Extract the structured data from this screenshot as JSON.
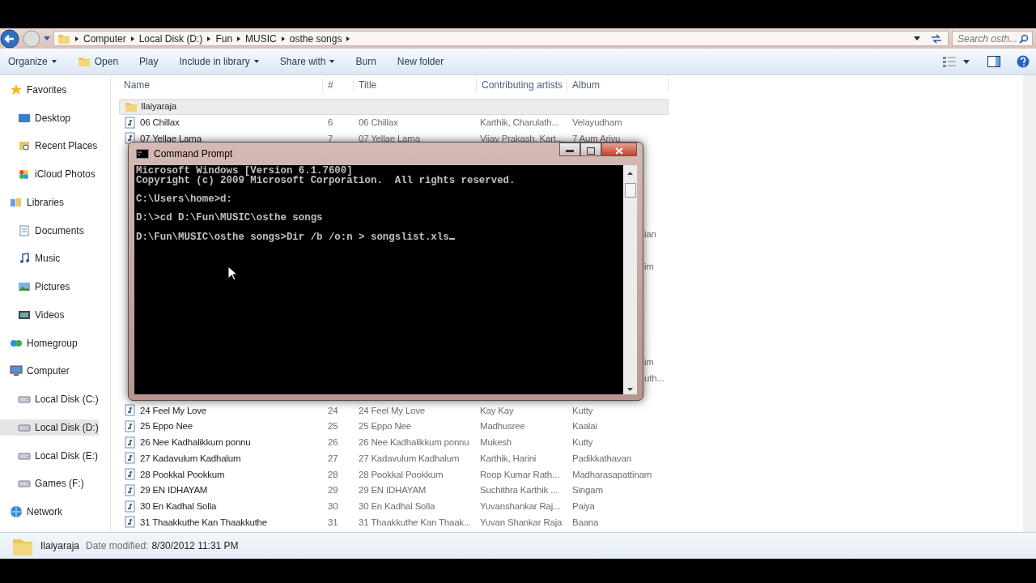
{
  "address_bar": {
    "breadcrumb": [
      "Computer",
      "Local Disk (D:)",
      "Fun",
      "MUSIC",
      "osthe songs"
    ],
    "search_placeholder": "Search osth..."
  },
  "toolbar": {
    "buttons": [
      {
        "label": "Organize",
        "kind": "menu"
      },
      {
        "label": "Open",
        "kind": "open"
      },
      {
        "label": "Play",
        "kind": "plain"
      },
      {
        "label": "Include in library",
        "kind": "menu"
      },
      {
        "label": "Share with",
        "kind": "menu"
      },
      {
        "label": "Burn",
        "kind": "plain"
      },
      {
        "label": "New folder",
        "kind": "plain"
      }
    ]
  },
  "sidebar": {
    "groups": [
      {
        "label": "Favorites",
        "kind": "star",
        "selected": false,
        "children": [
          {
            "label": "Desktop",
            "kind": "desktop",
            "selected": false
          },
          {
            "label": "Recent Places",
            "kind": "recent",
            "selected": false
          },
          {
            "label": "iCloud Photos",
            "kind": "photos",
            "selected": false
          }
        ]
      },
      {
        "label": "Libraries",
        "kind": "library",
        "selected": false,
        "children": [
          {
            "label": "Documents",
            "kind": "documents",
            "selected": false
          },
          {
            "label": "Music",
            "kind": "music",
            "selected": false
          },
          {
            "label": "Pictures",
            "kind": "pictures",
            "selected": false
          },
          {
            "label": "Videos",
            "kind": "videos",
            "selected": false
          }
        ]
      },
      {
        "label": "Homegroup",
        "kind": "homegroup",
        "selected": false
      },
      {
        "label": "Computer",
        "kind": "computer",
        "selected": false,
        "children": [
          {
            "label": "Local Disk (C:)",
            "kind": "disk",
            "selected": false
          },
          {
            "label": "Local Disk (D:)",
            "kind": "disk",
            "selected": true
          },
          {
            "label": "Local Disk (E:)",
            "kind": "disk",
            "selected": false
          },
          {
            "label": "Games (F:)",
            "kind": "disk",
            "selected": false
          }
        ]
      },
      {
        "label": "Network",
        "kind": "network",
        "selected": false
      }
    ]
  },
  "table": {
    "columns": [
      "Name",
      "#",
      "Title",
      "Contributing artists",
      "Album"
    ],
    "rows": [
      {
        "kind": "folder",
        "name": "Ilaiyaraja",
        "selected": true
      },
      {
        "kind": "song",
        "name": "06 Chillax",
        "number": "6",
        "title": "06 Chillax",
        "artists": "Karthik, Charulath...",
        "album": "Velayudham",
        "selected": false
      },
      {
        "kind": "song",
        "name": "07 Yellae Lama",
        "number": "7",
        "title": "07 Yellae Lama",
        "artists": "Vijay Prakash, Kart...",
        "album": "7 Aum Arivu",
        "selected": false
      },
      {
        "kind": "covered"
      },
      {
        "kind": "covered"
      },
      {
        "kind": "covered"
      },
      {
        "kind": "covered"
      },
      {
        "kind": "covered"
      },
      {
        "kind": "covered",
        "album": "ian"
      },
      {
        "kind": "covered"
      },
      {
        "kind": "covered",
        "album": "im"
      },
      {
        "kind": "covered"
      },
      {
        "kind": "covered"
      },
      {
        "kind": "covered"
      },
      {
        "kind": "covered"
      },
      {
        "kind": "covered"
      },
      {
        "kind": "covered",
        "album": "im"
      },
      {
        "kind": "covered",
        "album": "uth..."
      },
      {
        "kind": "covered"
      },
      {
        "kind": "song",
        "name": "24 Feel My Love",
        "number": "24",
        "title": "24 Feel My Love",
        "artists": "Kay Kay",
        "album": "Kutty",
        "selected": false
      },
      {
        "kind": "song",
        "name": "25 Eppo Nee",
        "number": "25",
        "title": "25 Eppo Nee",
        "artists": "Madhusree",
        "album": "Kaalai",
        "selected": false
      },
      {
        "kind": "song",
        "name": "26 Nee Kadhalikkum ponnu",
        "number": "26",
        "title": "26 Nee Kadhalikkum ponnu",
        "artists": "Mukesh",
        "album": "Kutty",
        "selected": false
      },
      {
        "kind": "song",
        "name": "27 Kadavulum Kadhalum",
        "number": "27",
        "title": "27 Kadavulum Kadhalum",
        "artists": "Karthik, Harini",
        "album": "Padikkathavan",
        "selected": false
      },
      {
        "kind": "song",
        "name": "28 Pookkal Pookkum",
        "number": "28",
        "title": "28 Pookkal Pookkum",
        "artists": "Roop Kumar Rath...",
        "album": "Madharasapattinam",
        "selected": false
      },
      {
        "kind": "song",
        "name": "29 EN IDHAYAM",
        "number": "29",
        "title": "29 EN IDHAYAM",
        "artists": "Suchithra Karthik ...",
        "album": "Singam",
        "selected": false
      },
      {
        "kind": "song",
        "name": "30 En Kadhal Solla",
        "number": "30",
        "title": "30 En Kadhal Solla",
        "artists": "Yuvanshankar Raj...",
        "album": "Paiya",
        "selected": false
      },
      {
        "kind": "song",
        "name": "31 Thaakkuthe Kan Thaakkuthe",
        "number": "31",
        "title": "31 Thaakkuthe Kan Thaak...",
        "artists": "Yuvan Shankar Raja",
        "album": "Baana",
        "selected": false
      }
    ]
  },
  "status_bar": {
    "name": "Ilaiyaraja",
    "label": "Date modified:",
    "value": "8/30/2012 11:31 PM"
  },
  "console": {
    "title": "Command Prompt",
    "cursor": true,
    "blocks": [
      [
        "Microsoft Windows [Version 6.1.7600]",
        "Copyright (c) 2009 Microsoft Corporation.  All rights reserved."
      ],
      [
        "C:\\Users\\home>d:"
      ],
      [
        "D:\\>cd D:\\Fun\\MUSIC\\osthe songs"
      ],
      [
        "D:\\Fun\\MUSIC\\osthe songs>Dir /b /o:n > songslist.xls"
      ]
    ]
  }
}
